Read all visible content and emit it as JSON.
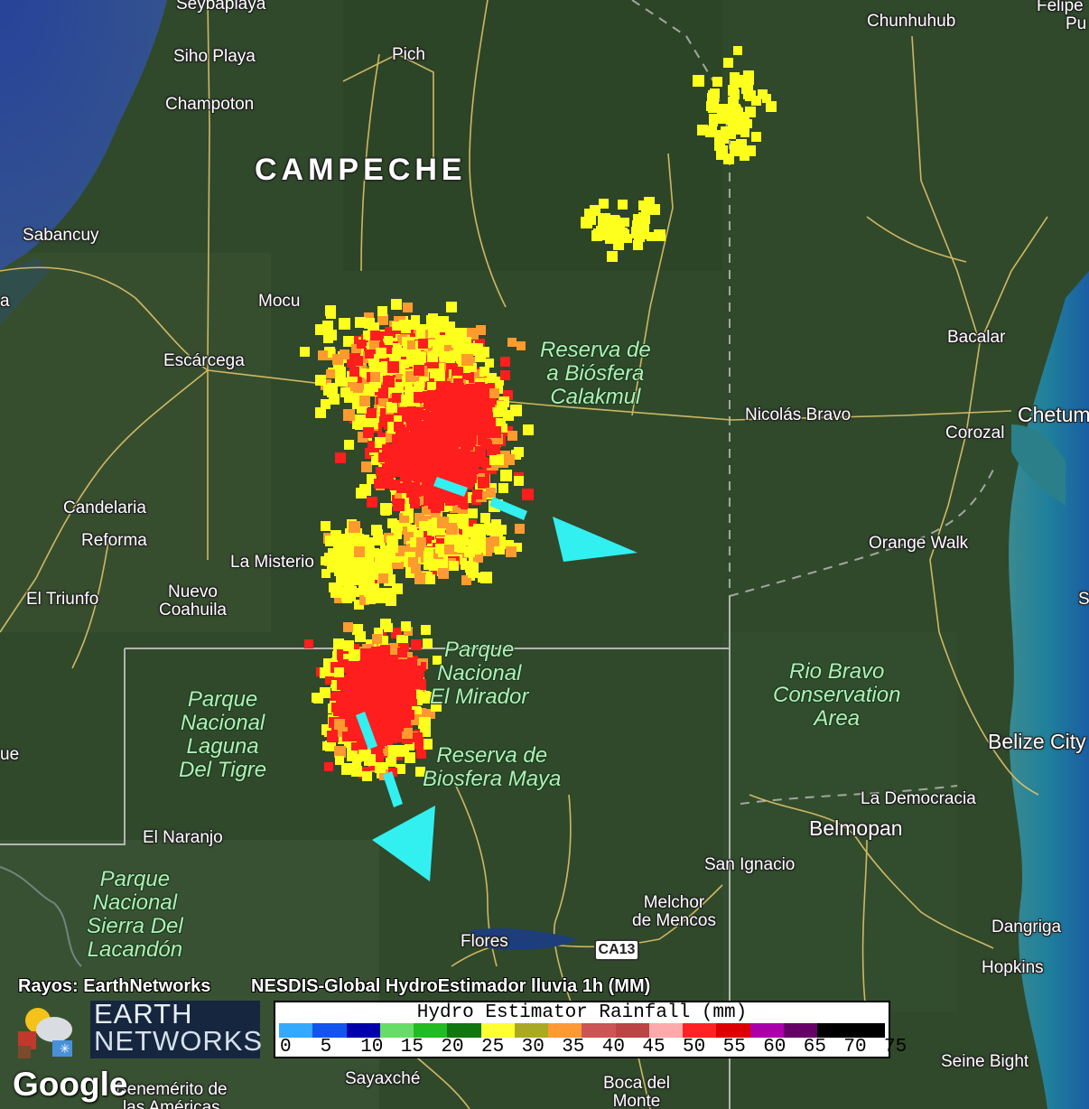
{
  "map": {
    "region_label": "CAMPECHE",
    "places": [
      {
        "name": "Seybaplaya"
      },
      {
        "name": "Siho Playa"
      },
      {
        "name": "Pich"
      },
      {
        "name": "Champoton"
      },
      {
        "name": "Chunhuhub"
      },
      {
        "name": "Felipe"
      },
      {
        "name": "Pu"
      },
      {
        "name": "Sabancuy"
      },
      {
        "name": "Mocu"
      },
      {
        "name": "Escárcega"
      },
      {
        "name": "Bacalar"
      },
      {
        "name": "Nicolás Bravo"
      },
      {
        "name": "Chetum"
      },
      {
        "name": "Corozal"
      },
      {
        "name": "Candelaria"
      },
      {
        "name": "Reforma"
      },
      {
        "name": "La Misterio"
      },
      {
        "name": "Orange Walk"
      },
      {
        "name": "El Triunfo"
      },
      {
        "name": "Nuevo\nCoahuila"
      },
      {
        "name": "S"
      },
      {
        "name": "Belize City"
      },
      {
        "name": "La Democracia"
      },
      {
        "name": "Belmopan"
      },
      {
        "name": "El Naranjo"
      },
      {
        "name": "San Ignacio"
      },
      {
        "name": "Melchor\nde Mencos"
      },
      {
        "name": "Flores"
      },
      {
        "name": "Dangriga"
      },
      {
        "name": "Hopkins"
      },
      {
        "name": "Sayaxché"
      },
      {
        "name": "Boca del\nMonte"
      },
      {
        "name": "Seine Bight"
      },
      {
        "name": "Benemérito de\nlas Américas"
      },
      {
        "name": "ue"
      },
      {
        "name": "a"
      }
    ],
    "parks": [
      {
        "name": "Reserva de\na Biósfera\nCalakmul"
      },
      {
        "name": "Parque\nNacional\nEl Mirador"
      },
      {
        "name": "Rio Bravo\nConservation\nArea"
      },
      {
        "name": "Parque\nNacional\nLaguna\nDel Tigre"
      },
      {
        "name": "Reserva de\nBiosfera Maya"
      },
      {
        "name": "Parque\nNacional\nSierra Del\nLacandón"
      }
    ],
    "road_shield": "CA13",
    "motion_arrow_color": "#33f0f0"
  },
  "attribution": {
    "lightning_credit": "Rayos: EarthNetworks",
    "product_title": "NESDIS-Global HydroEstimador lluvia 1h (MM)",
    "logo_text_line1": "EARTH",
    "logo_text_line2": "NETWORKS",
    "google": "Google"
  },
  "legend": {
    "title": "Hydro Estimator Rainfall (mm)",
    "ticks": [
      "0",
      "5",
      "10",
      "15",
      "20",
      "25",
      "30",
      "35",
      "40",
      "45",
      "50",
      "55",
      "60",
      "65",
      "70",
      "75"
    ],
    "colors": [
      "#33aaff",
      "#1155ee",
      "#0000aa",
      "#66dd66",
      "#22bb22",
      "#117711",
      "#ffff33",
      "#aaaa22",
      "#ff9933",
      "#cc5555",
      "#bb4444",
      "#ffaaaa",
      "#ff2222",
      "#dd0000",
      "#aa00aa",
      "#660066",
      "#000000",
      "#000000"
    ],
    "rain_colors": {
      "light": "#ffff1e",
      "moderate": "#ff9a2e",
      "heavy": "#ff1e1e"
    }
  }
}
